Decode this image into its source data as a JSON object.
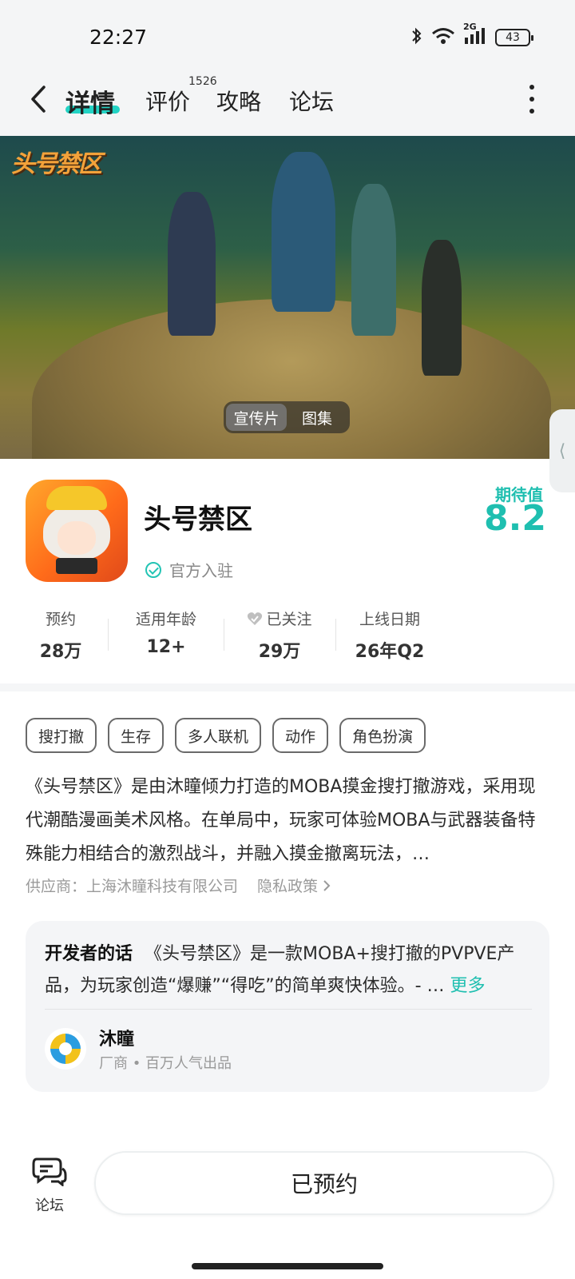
{
  "status_bar": {
    "time": "22:27",
    "battery": "43",
    "network": "2G"
  },
  "nav": {
    "tabs": [
      {
        "label": "详情",
        "active": true
      },
      {
        "label": "评价",
        "badge": "1526"
      },
      {
        "label": "攻略"
      },
      {
        "label": "论坛"
      }
    ]
  },
  "banner": {
    "logo_text": "头号禁区",
    "media_options": [
      {
        "label": "宣传片",
        "active": true
      },
      {
        "label": "图集"
      }
    ]
  },
  "app": {
    "title": "头号禁区",
    "official_label": "官方入驻",
    "expect_label": "期待值",
    "expect_value": "8.2"
  },
  "stats": [
    {
      "label": "预约",
      "value": "28万"
    },
    {
      "label": "适用年龄",
      "value": "12+"
    },
    {
      "label": "已关注",
      "value": "29万",
      "icon": "heart-icon"
    },
    {
      "label": "上线日期",
      "value": "26年Q2"
    }
  ],
  "tags": [
    "搜打撤",
    "生存",
    "多人联机",
    "动作",
    "角色扮演"
  ],
  "description": "《头号禁区》是由沐瞳倾力打造的MOBA摸金搜打撤游戏，采用现代潮酷漫画美术风格。在单局中，玩家可体验MOBA与武器装备特殊能力相结合的激烈战斗，并融入摸金撤离玩法，…",
  "supplier": "供应商：上海沐瞳科技有限公司",
  "privacy": "隐私政策",
  "developer": {
    "heading": "开发者的话",
    "text": "《头号禁区》是一款MOBA+搜打撤的PVPVE产品，为玩家创造“爆赚”“得吃”的简单爽快体验。- …",
    "more": "更多",
    "name": "沐瞳",
    "subtitle": "厂商 • 百万人气出品"
  },
  "bottom": {
    "forum_label": "论坛",
    "reserve_label": "已预约"
  },
  "colors": {
    "accent": "#1fbfb0",
    "tab_underline": "#23d3c4"
  }
}
